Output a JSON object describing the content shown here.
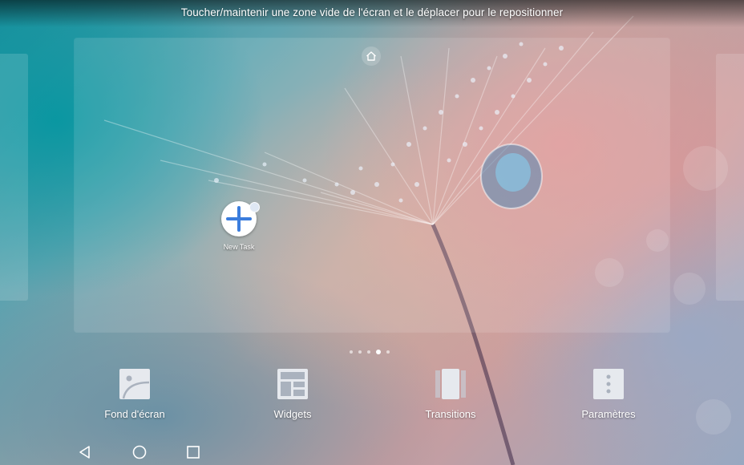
{
  "header": {
    "hint_text": "Toucher/maintenir une zone vide de l'écran et le déplacer pour le repositionner"
  },
  "home_screen": {
    "apps": [
      {
        "label": "New Task",
        "icon": "plus-icon",
        "accent": "#3b7ddd"
      }
    ],
    "pages": {
      "count": 5,
      "current": 4
    }
  },
  "toolbar": {
    "items": [
      {
        "label": "Fond d'écran",
        "icon": "wallpaper-icon"
      },
      {
        "label": "Widgets",
        "icon": "widgets-icon"
      },
      {
        "label": "Transitions",
        "icon": "transitions-icon"
      },
      {
        "label": "Paramètres",
        "icon": "settings-icon"
      }
    ]
  },
  "navigation": {
    "buttons": [
      "back-icon",
      "home-circle-icon",
      "recents-icon"
    ]
  }
}
